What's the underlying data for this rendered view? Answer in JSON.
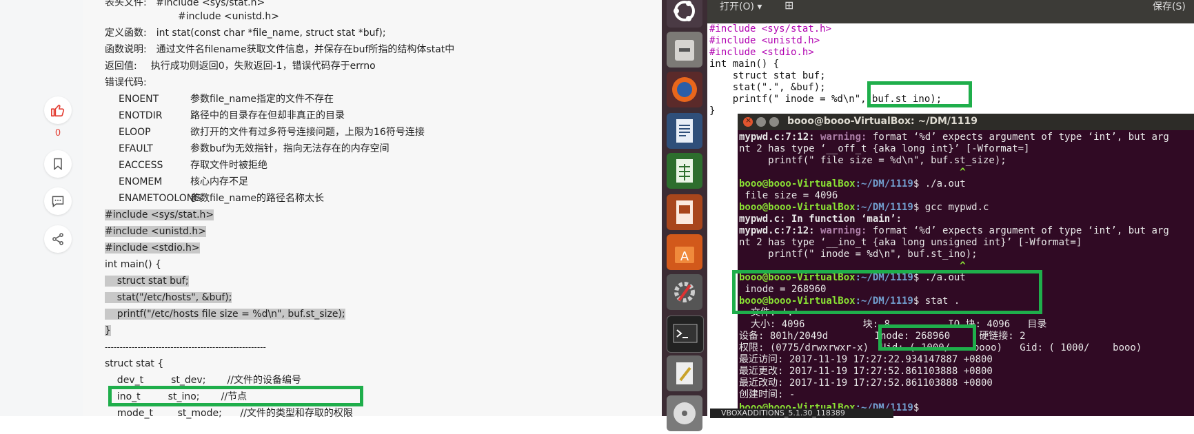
{
  "blog": {
    "like_count": "0",
    "header_line": "表头文件:   #include <sys/stat.h>",
    "header_line2": "#include <unistd.h>",
    "def_label": "定义函数:",
    "def_value": "int stat(const char *file_name, struct stat *buf);",
    "desc_label": "函数说明:",
    "desc_value": "通过文件名filename获取文件信息，并保存在buf所指的结构体stat中",
    "ret_label": "返回值:",
    "ret_value": "执行成功则返回0，失败返回-1，错误代码存于errno",
    "err_label": "错误代码:",
    "errors": [
      {
        "name": "ENOENT",
        "desc": "参数file_name指定的文件不存在"
      },
      {
        "name": "ENOTDIR",
        "desc": "路径中的目录存在但却非真正的目录"
      },
      {
        "name": "ELOOP",
        "desc": "欲打开的文件有过多符号连接问题，上限为16符号连接"
      },
      {
        "name": "EFAULT",
        "desc": "参数buf为无效指针，指向无法存在的内存空间"
      },
      {
        "name": "EACCESS",
        "desc": "存取文件时被拒绝"
      },
      {
        "name": "ENOMEM",
        "desc": "核心内存不足"
      },
      {
        "name": "ENAMETOOLONG",
        "desc": "参数file_name的路径名称太长"
      }
    ],
    "code_lines": [
      "#include <sys/stat.h>",
      "#include <unistd.h>",
      "#include <stdio.h>",
      "int main() {",
      "    struct stat buf;",
      "    stat(\"/etc/hosts\", &buf);",
      "    printf(\"/etc/hosts file size = %d\\n\", buf.st_size);",
      "}"
    ],
    "separator": "------------------------------------------------------",
    "struct_lines": [
      "struct stat {",
      "    dev_t         st_dev;       //文件的设备编号",
      "    ino_t         st_ino;       //节点",
      "    mode_t        st_mode;      //文件的类型和存取的权限"
    ]
  },
  "editor": {
    "open_label": "打开(O)",
    "save_label": "保存(S)",
    "code": [
      "#include <sys/stat.h>",
      "#include <unistd.h>",
      "#include <stdio.h>",
      "int main() {",
      "    struct stat buf;",
      "    stat(\".\", &buf);",
      "    printf(\" inode = %d\\n\", buf.st_ino);",
      "}"
    ]
  },
  "terminal": {
    "title": "booo@booo-VirtualBox: ~/DM/1119",
    "prompt_user": "booo@booo-VirtualBox",
    "prompt_path": ":~/DM/1119",
    "lines": {
      "w1_file": "mypwd.c:7:12:",
      "w1_word": "warning:",
      "w1_rest": "format ‘%d’ expects argument of type ‘int’, but arg",
      "w1_l2": "nt 2 has type ‘__off_t {aka long int}’ [-Wformat=]",
      "w1_l3": "     printf(\" file size = %d\\n\", buf.st_size);",
      "caret": "                                      ^",
      "cmd1": "$ ./a.out",
      "out1": " file size = 4096",
      "cmd2": "$ gcc mypwd.c",
      "in_func": "mypwd.c: In function ‘main’:",
      "w2_file": "mypwd.c:7:12:",
      "w2_word": "warning:",
      "w2_rest": "format ‘%d’ expects argument of type ‘int’, but arg",
      "w2_l2": "nt 2 has type ‘__ino_t {aka long unsigned int}’ [-Wformat=]",
      "w2_l3": "     printf(\" inode = %d\\n\", buf.st_ino);",
      "cmd3": "$ ./a.out",
      "out3": " inode = 268960",
      "cmd4": "$ stat .",
      "stat_file": "  文件: '.'",
      "stat_size": "  大小: 4096          块: 8          IO 块: 4096   目录",
      "stat_dev": "设备: 801h/2049d        Inode: 268960     硬链接: 2",
      "stat_perm": "权限: (0775/drwxrwxr-x)  Uid: ( 1000/    booo)   Gid: ( 1000/    booo)",
      "stat_access": "最近访问: 2017-11-19 17:27:22.934147887 +0800",
      "stat_modify": "最近更改: 2017-11-19 17:27:52.861103888 +0800",
      "stat_change": "最近改动: 2017-11-19 17:27:52.861103888 +0800",
      "stat_birth": "创建时间: -",
      "cmd5": "$"
    }
  },
  "tooltip": "VBOXADDITIONS_5.1.30_118389",
  "colors": {
    "highlight_box": "#1fae4b",
    "terminal_bg": "#300a24",
    "launcher_bg": "#3c2c34"
  }
}
